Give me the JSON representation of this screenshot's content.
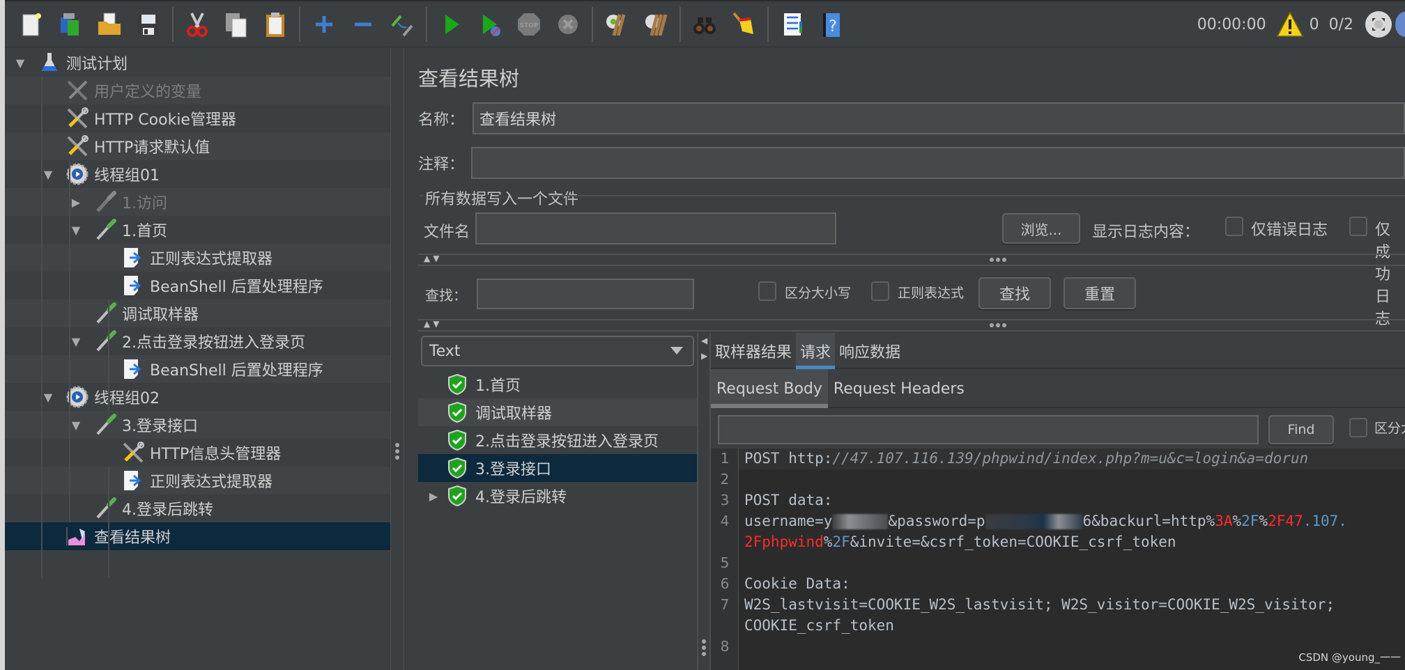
{
  "toolbar": {
    "buttons": [
      {
        "name": "new-icon",
        "tooltip": "New"
      },
      {
        "name": "templates-icon",
        "tooltip": "Templates"
      },
      {
        "name": "open-icon",
        "tooltip": "Open"
      },
      {
        "name": "save-icon",
        "tooltip": "Save"
      },
      {
        "name": "cut-icon",
        "tooltip": "Cut"
      },
      {
        "name": "copy-icon",
        "tooltip": "Copy"
      },
      {
        "name": "paste-icon",
        "tooltip": "Paste"
      },
      {
        "name": "expand-icon",
        "tooltip": "Expand"
      },
      {
        "name": "collapse-icon",
        "tooltip": "Collapse"
      },
      {
        "name": "toggle-icon",
        "tooltip": "Toggle"
      },
      {
        "name": "start-icon",
        "tooltip": "Start"
      },
      {
        "name": "start-no-pauses-icon",
        "tooltip": "Start no pauses"
      },
      {
        "name": "stop-icon",
        "tooltip": "Stop"
      },
      {
        "name": "shutdown-icon",
        "tooltip": "Shutdown"
      },
      {
        "name": "clear-icon",
        "tooltip": "Clear"
      },
      {
        "name": "clear-all-icon",
        "tooltip": "Clear All"
      },
      {
        "name": "search-icon",
        "tooltip": "Search"
      },
      {
        "name": "reset-search-icon",
        "tooltip": "Reset Search"
      },
      {
        "name": "function-helper-icon",
        "tooltip": "Function Helper"
      },
      {
        "name": "help-icon",
        "tooltip": "Help"
      }
    ],
    "timer": "00:00:00",
    "warning_count": "0",
    "threads": "0/2"
  },
  "tree": {
    "items": [
      {
        "label": "测试计划",
        "icon": "test-plan-icon",
        "level": 0,
        "expanded": true,
        "disabled": false
      },
      {
        "label": "用户定义的变量",
        "icon": "config-element-icon",
        "level": 1,
        "expanded": null,
        "disabled": true
      },
      {
        "label": "HTTP Cookie管理器",
        "icon": "config-element-icon",
        "level": 1,
        "expanded": null,
        "disabled": false
      },
      {
        "label": "HTTP请求默认值",
        "icon": "config-element-icon",
        "level": 1,
        "expanded": null,
        "disabled": false
      },
      {
        "label": "线程组01",
        "icon": "thread-group-icon",
        "level": 1,
        "expanded": true,
        "disabled": false
      },
      {
        "label": "1.访问",
        "icon": "sampler-icon",
        "level": 2,
        "expanded": false,
        "disabled": true
      },
      {
        "label": "1.首页",
        "icon": "sampler-icon",
        "level": 2,
        "expanded": true,
        "disabled": false
      },
      {
        "label": "正则表达式提取器",
        "icon": "post-processor-icon",
        "level": 3,
        "expanded": null,
        "disabled": false
      },
      {
        "label": "BeanShell 后置处理程序",
        "icon": "post-processor-icon",
        "level": 3,
        "expanded": null,
        "disabled": false
      },
      {
        "label": "调试取样器",
        "icon": "sampler-icon",
        "level": 2,
        "expanded": null,
        "disabled": false
      },
      {
        "label": "2.点击登录按钮进入登录页",
        "icon": "sampler-icon",
        "level": 2,
        "expanded": true,
        "disabled": false
      },
      {
        "label": "BeanShell 后置处理程序",
        "icon": "post-processor-icon",
        "level": 3,
        "expanded": null,
        "disabled": false
      },
      {
        "label": "线程组02",
        "icon": "thread-group-icon",
        "level": 1,
        "expanded": true,
        "disabled": false
      },
      {
        "label": "3.登录接口",
        "icon": "sampler-icon",
        "level": 2,
        "expanded": true,
        "disabled": false
      },
      {
        "label": "HTTP信息头管理器",
        "icon": "config-element-icon",
        "level": 3,
        "expanded": null,
        "disabled": false
      },
      {
        "label": "正则表达式提取器",
        "icon": "post-processor-icon",
        "level": 3,
        "expanded": null,
        "disabled": false
      },
      {
        "label": "4.登录后跳转",
        "icon": "sampler-icon",
        "level": 2,
        "expanded": null,
        "disabled": false
      },
      {
        "label": "查看结果树",
        "icon": "listener-icon",
        "level": 1,
        "expanded": null,
        "disabled": false,
        "selected": true
      }
    ]
  },
  "panel": {
    "title": "查看结果树",
    "name_label": "名称：",
    "name_value": "查看结果树",
    "comment_label": "注释：",
    "comment_value": "",
    "file_section_title": "所有数据写入一个文件",
    "filename_label": "文件名",
    "filename_value": "",
    "browse_button": "浏览...",
    "log_content_label": "显示日志内容：",
    "errors_only_label": "仅错误日志",
    "errors_only_checked": false,
    "success_only_label": "仅成功日志",
    "success_only_checked": false
  },
  "search": {
    "label": "查找：",
    "value": "",
    "case_sensitive_label": "区分大小写",
    "case_sensitive_checked": false,
    "regex_label": "正则表达式",
    "regex_checked": false,
    "find_button": "查找",
    "reset_button": "重置"
  },
  "results": {
    "renderer": "Text",
    "items": [
      {
        "label": "1.首页",
        "status": "success",
        "has_children": false
      },
      {
        "label": "调试取样器",
        "status": "success",
        "has_children": false
      },
      {
        "label": "2.点击登录按钮进入登录页",
        "status": "success",
        "has_children": false
      },
      {
        "label": "3.登录接口",
        "status": "success",
        "has_children": false,
        "selected": true
      },
      {
        "label": "4.登录后跳转",
        "status": "success",
        "has_children": true
      }
    ]
  },
  "detail": {
    "tabs": [
      {
        "label": "取样器结果",
        "active": false
      },
      {
        "label": "请求",
        "active": true
      },
      {
        "label": "响应数据",
        "active": false
      }
    ],
    "subtabs": [
      {
        "label": "Request Body",
        "active": true
      },
      {
        "label": "Request Headers",
        "active": false
      }
    ],
    "find_value": "",
    "find_button": "Find",
    "case_label": "区分大小写",
    "line_numbers": [
      "1",
      "2",
      "3",
      "4",
      "5",
      "6",
      "7",
      "8"
    ],
    "code": {
      "l1_method": "POST http:",
      "l1_url": "//47.107.116.139/phpwind/index.php?m=u&c=login&a=dorun",
      "l3": "POST data:",
      "l4_a": "username=y",
      "l4_b": "&password=p",
      "l4_c": "6&backurl=http",
      "l4_d": "%",
      "l4_e": "3A",
      "l4_f": "%",
      "l4_g": "2F",
      "l4_h": "%",
      "l4_i": "2F47",
      "l4_j": ".107.",
      "l4w_a": "2Fphpwind",
      "l4w_b": "%",
      "l4w_c": "2F",
      "l4w_d": "&invite=&csrf_token=COOKIE_csrf_token",
      "l6": "Cookie Data:",
      "l7": "W2S_lastvisit=COOKIE_W2S_lastvisit; W2S_visitor=COOKIE_W2S_visitor;",
      "l7w": "COOKIE_csrf_token"
    }
  },
  "watermark": "CSDN @young_一一",
  "colors": {
    "background": "#3c3f41",
    "selection": "#0d293e",
    "active_tab_underline": "#4a88c7",
    "success": "#1fa31f",
    "encoded_red": "#ff2a2a",
    "encoded_blue": "#5c98cd"
  }
}
